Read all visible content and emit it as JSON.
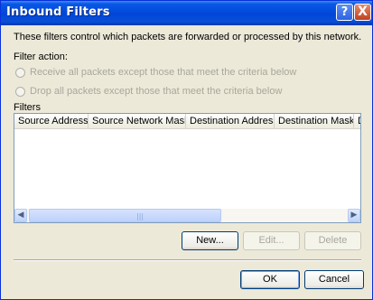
{
  "window": {
    "title": "Inbound Filters",
    "help_glyph": "?",
    "close_glyph": "X"
  },
  "description": "These filters control which packets are forwarded or processed by this network.",
  "filter_action": {
    "label": "Filter action:",
    "options": [
      "Receive all packets except those that meet the criteria below",
      "Drop all packets except those that meet the criteria below"
    ]
  },
  "filters": {
    "label": "Filters",
    "columns": [
      "Source Address",
      "Source Network Mask",
      "Destination Address",
      "Destination Mask",
      "D"
    ],
    "rows": []
  },
  "buttons": {
    "new": "New...",
    "edit": "Edit...",
    "delete": "Delete",
    "ok": "OK",
    "cancel": "Cancel"
  }
}
